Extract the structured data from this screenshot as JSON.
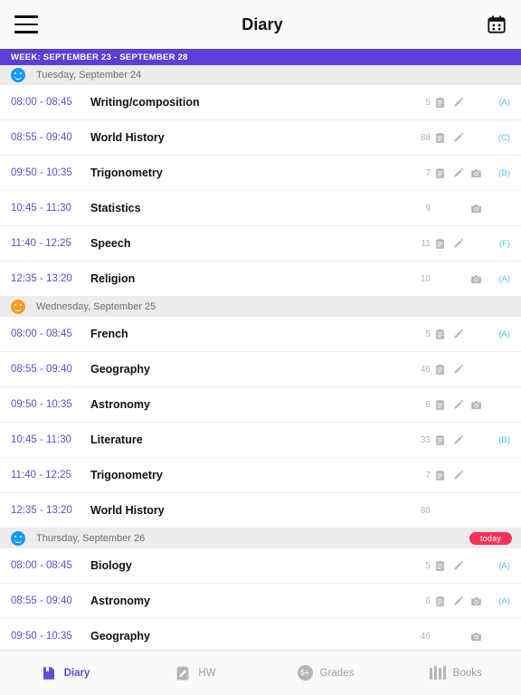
{
  "header": {
    "title": "Diary",
    "menu_icon": "hamburger-menu-icon",
    "calendar_icon": "calendar-icon"
  },
  "week_banner": {
    "label": "WEEK: SEPTEMBER 23 - SEPTEMBER 28"
  },
  "colors": {
    "accent_purple": "#5b4fd6",
    "banner_purple": "#5b3fd6",
    "grade_blue": "#4cc3f2",
    "today_badge": "#f6325b",
    "smiley_blue": "#159af5",
    "smiley_orange": "#f59a23",
    "muted_gray": "#b3b3b3"
  },
  "days": [
    {
      "label": "Tuesday, September 24",
      "mood": "blue",
      "badge": null,
      "lessons": [
        {
          "time": "08:00 - 08:45",
          "subject": "Writing/composition",
          "count": "5",
          "note": true,
          "pencil": true,
          "camera": false,
          "grade": "(A)"
        },
        {
          "time": "08:55 - 09:40",
          "subject": "World History",
          "count": "88",
          "note": true,
          "pencil": true,
          "camera": false,
          "grade": "(C)"
        },
        {
          "time": "09:50 - 10:35",
          "subject": "Trigonometry",
          "count": "7",
          "note": true,
          "pencil": true,
          "camera": true,
          "grade": "(B)"
        },
        {
          "time": "10:45 - 11:30",
          "subject": "Statistics",
          "count": "9",
          "note": false,
          "pencil": false,
          "camera": true,
          "grade": ""
        },
        {
          "time": "11:40 - 12:25",
          "subject": "Speech",
          "count": "11",
          "note": true,
          "pencil": true,
          "camera": false,
          "grade": "(F)"
        },
        {
          "time": "12:35 - 13:20",
          "subject": "Religion",
          "count": "10",
          "note": false,
          "pencil": false,
          "camera": true,
          "grade": "(A)"
        }
      ]
    },
    {
      "label": "Wednesday, September 25",
      "mood": "orange",
      "badge": null,
      "lessons": [
        {
          "time": "08:00 - 08:45",
          "subject": "French",
          "count": "5",
          "note": true,
          "pencil": true,
          "camera": false,
          "grade": "(A)"
        },
        {
          "time": "08:55 - 09:40",
          "subject": "Geography",
          "count": "46",
          "note": true,
          "pencil": true,
          "camera": false,
          "grade": ""
        },
        {
          "time": "09:50 - 10:35",
          "subject": "Astronomy",
          "count": "6",
          "note": true,
          "pencil": true,
          "camera": true,
          "grade": ""
        },
        {
          "time": "10:45 - 11:30",
          "subject": "Literature",
          "count": "33",
          "note": true,
          "pencil": true,
          "camera": false,
          "grade": "(B)"
        },
        {
          "time": "11:40 - 12:25",
          "subject": "Trigonometry",
          "count": "7",
          "note": true,
          "pencil": true,
          "camera": false,
          "grade": ""
        },
        {
          "time": "12:35 - 13:20",
          "subject": "World History",
          "count": "88",
          "note": false,
          "pencil": false,
          "camera": false,
          "grade": ""
        }
      ]
    },
    {
      "label": "Thursday, September 26",
      "mood": "blue",
      "badge": "today",
      "lessons": [
        {
          "time": "08:00 - 08:45",
          "subject": "Biology",
          "count": "5",
          "note": true,
          "pencil": true,
          "camera": false,
          "grade": "(A)"
        },
        {
          "time": "08:55 - 09:40",
          "subject": "Astronomy",
          "count": "6",
          "note": true,
          "pencil": true,
          "camera": true,
          "grade": "(A)"
        },
        {
          "time": "09:50 - 10:35",
          "subject": "Geography",
          "count": "46",
          "note": false,
          "pencil": false,
          "camera": true,
          "grade": ""
        }
      ]
    }
  ],
  "bottom_nav": [
    {
      "label": "Diary",
      "icon": "diary-book-icon",
      "active": true
    },
    {
      "label": "HW",
      "icon": "homework-pencil-notepad-icon",
      "active": false
    },
    {
      "label": "Grades",
      "icon": "grades-circle-icon",
      "badge_text": "5+",
      "active": false
    },
    {
      "label": "Books",
      "icon": "books-spines-icon",
      "active": false
    }
  ]
}
